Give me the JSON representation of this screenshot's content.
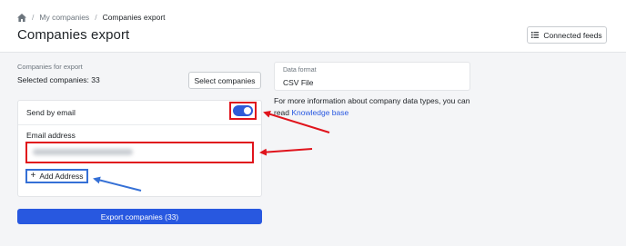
{
  "breadcrumb": {
    "home_icon": "home-icon",
    "separator": "/",
    "items": [
      "My companies",
      "Companies export"
    ]
  },
  "page": {
    "title": "Companies export"
  },
  "header_actions": {
    "connected_feeds_label": "Connected feeds",
    "connected_feeds_icon": "list-icon"
  },
  "export_panel": {
    "companies_label": "Companies for export",
    "selected_text": "Selected companies: 33",
    "select_button_label": "Select companies"
  },
  "data_format": {
    "label": "Data format",
    "value": "CSV File",
    "info_prefix": "For more information about company data types, you can read ",
    "info_link": "Knowledge base"
  },
  "send_by_email": {
    "label": "Send by email",
    "toggle_on": true,
    "email_label": "Email address",
    "email_value": "",
    "add_address_label": "Add Address",
    "add_icon": "plus-icon"
  },
  "export_button_label": "Export companies (33)",
  "colors": {
    "primary": "#2858e0",
    "toggle": "#2f5ad8",
    "annotation_red": "#e0141c",
    "annotation_blue": "#3570d6"
  }
}
